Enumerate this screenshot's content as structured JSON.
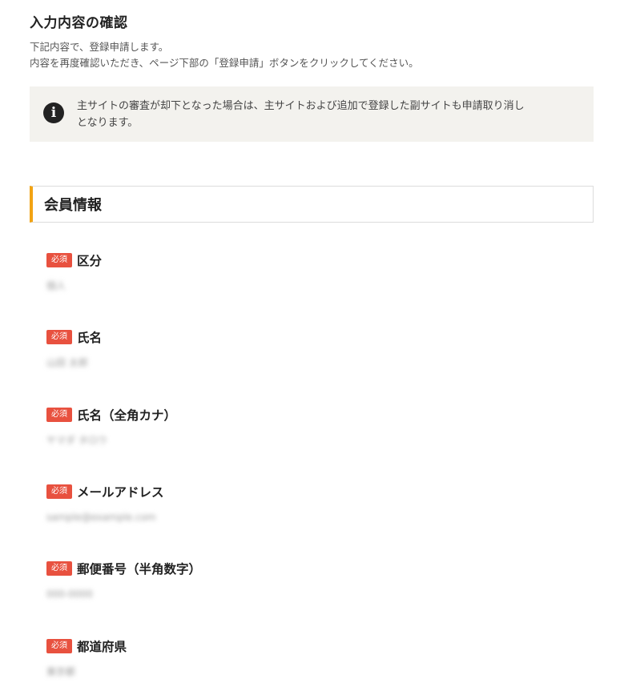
{
  "page": {
    "title": "入力内容の確認",
    "description_line1": "下記内容で、登録申請します。",
    "description_line2": "内容を再度確認いただき、ページ下部の「登録申請」ボタンをクリックしてください。"
  },
  "notice": {
    "icon": "info-icon",
    "text_line1": "主サイトの審査が却下となった場合は、主サイトおよび追加で登録した副サイトも申請取り消し",
    "text_line2": "となります。"
  },
  "section": {
    "title": "会員情報"
  },
  "required_badge": "必須",
  "fields": [
    {
      "label": "区分",
      "value": "個人"
    },
    {
      "label": "氏名",
      "value": "山田 太郎"
    },
    {
      "label": "氏名（全角カナ）",
      "value": "ヤマダ タロウ"
    },
    {
      "label": "メールアドレス",
      "value": "sample@example.com"
    },
    {
      "label": "郵便番号（半角数字）",
      "value": "000-0000"
    },
    {
      "label": "都道府県",
      "value": "東京都"
    }
  ],
  "colors": {
    "accent": "#f2a313",
    "required_badge": "#e8513f",
    "notice_bg": "#f3f2ee"
  }
}
